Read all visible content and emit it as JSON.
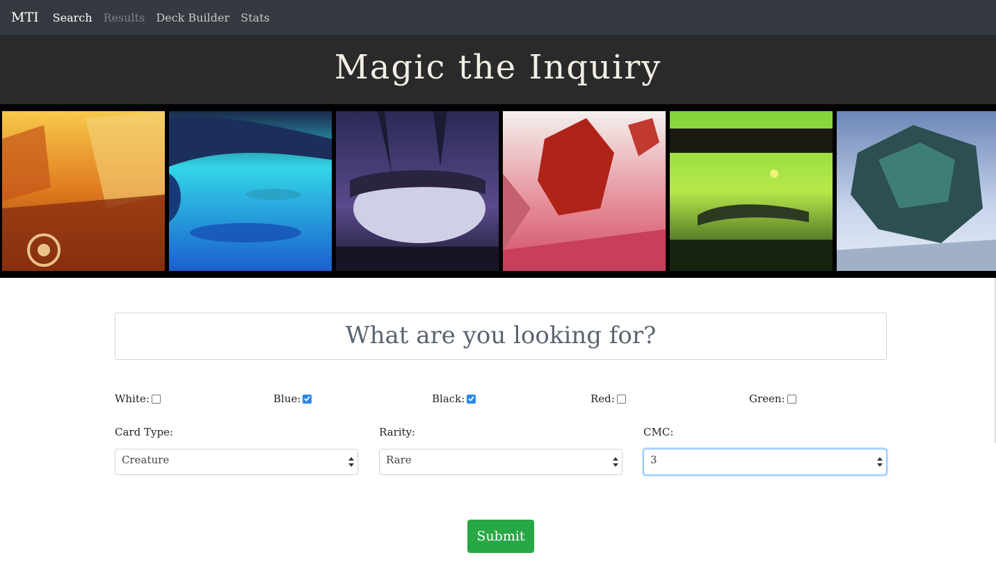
{
  "navbar": {
    "brand": "MTI",
    "links": [
      {
        "label": "Search",
        "state": "active"
      },
      {
        "label": "Results",
        "state": "disabled"
      },
      {
        "label": "Deck Builder",
        "state": "normal"
      },
      {
        "label": "Stats",
        "state": "normal"
      }
    ]
  },
  "header": {
    "title": "Magic the Inquiry"
  },
  "banner": {
    "panels": [
      "plains-art",
      "island-art",
      "swamp-art",
      "mountain-art",
      "forest-art",
      "wastes-art"
    ]
  },
  "search": {
    "placeholder": "What are you looking for?"
  },
  "colors": [
    {
      "label": "White:",
      "checked": false
    },
    {
      "label": "Blue:",
      "checked": true
    },
    {
      "label": "Black:",
      "checked": true
    },
    {
      "label": "Red:",
      "checked": false
    },
    {
      "label": "Green:",
      "checked": false
    }
  ],
  "filters": {
    "card_type": {
      "label": "Card Type:",
      "value": "Creature"
    },
    "rarity": {
      "label": "Rarity:",
      "value": "Rare"
    },
    "cmc": {
      "label": "CMC:",
      "value": "3"
    }
  },
  "submit": {
    "label": "Submit"
  },
  "theme": {
    "navbar_bg": "#343a40",
    "title_bg": "#2a2a2a",
    "checkbox_checked": "#2b88e6",
    "submit_bg": "#28a745"
  }
}
